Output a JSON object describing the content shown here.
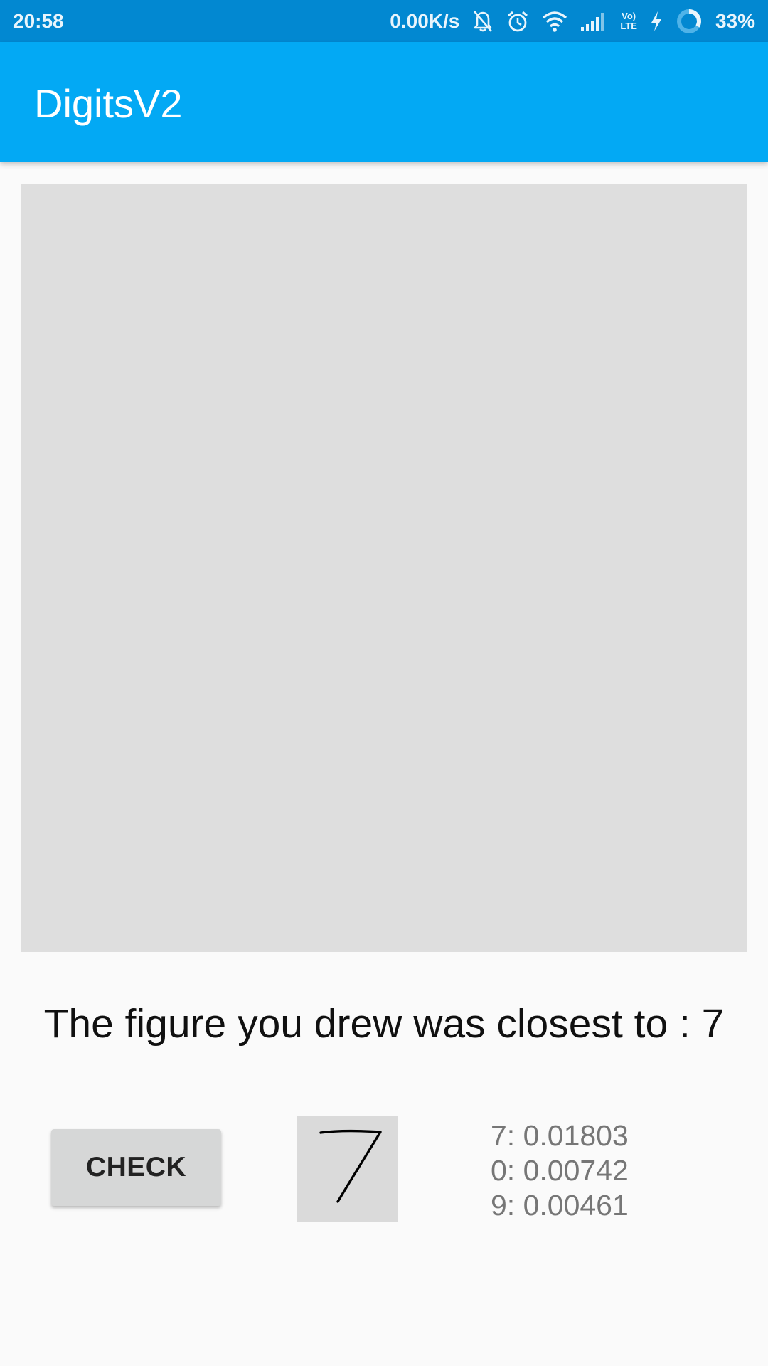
{
  "status_bar": {
    "time": "20:58",
    "network_speed": "0.00K/s",
    "lte_top": "Vo)",
    "lte_bottom": "LTE",
    "battery": "33%",
    "icons": [
      "bell-off-icon",
      "alarm-icon",
      "wifi-icon",
      "signal-icon",
      "volte-icon",
      "charging-icon",
      "battery-ring-icon"
    ]
  },
  "app_bar": {
    "title": "DigitsV2",
    "color": "#03a9f4"
  },
  "canvas": {
    "background": "#dedede"
  },
  "result": {
    "text": "The figure you drew was closest to : 7"
  },
  "controls": {
    "check_label": "CHECK"
  },
  "thumbnail": {
    "digit_icon": "handwritten-seven"
  },
  "scores": [
    "7: 0.01803",
    "0: 0.00742",
    "9: 0.00461"
  ]
}
